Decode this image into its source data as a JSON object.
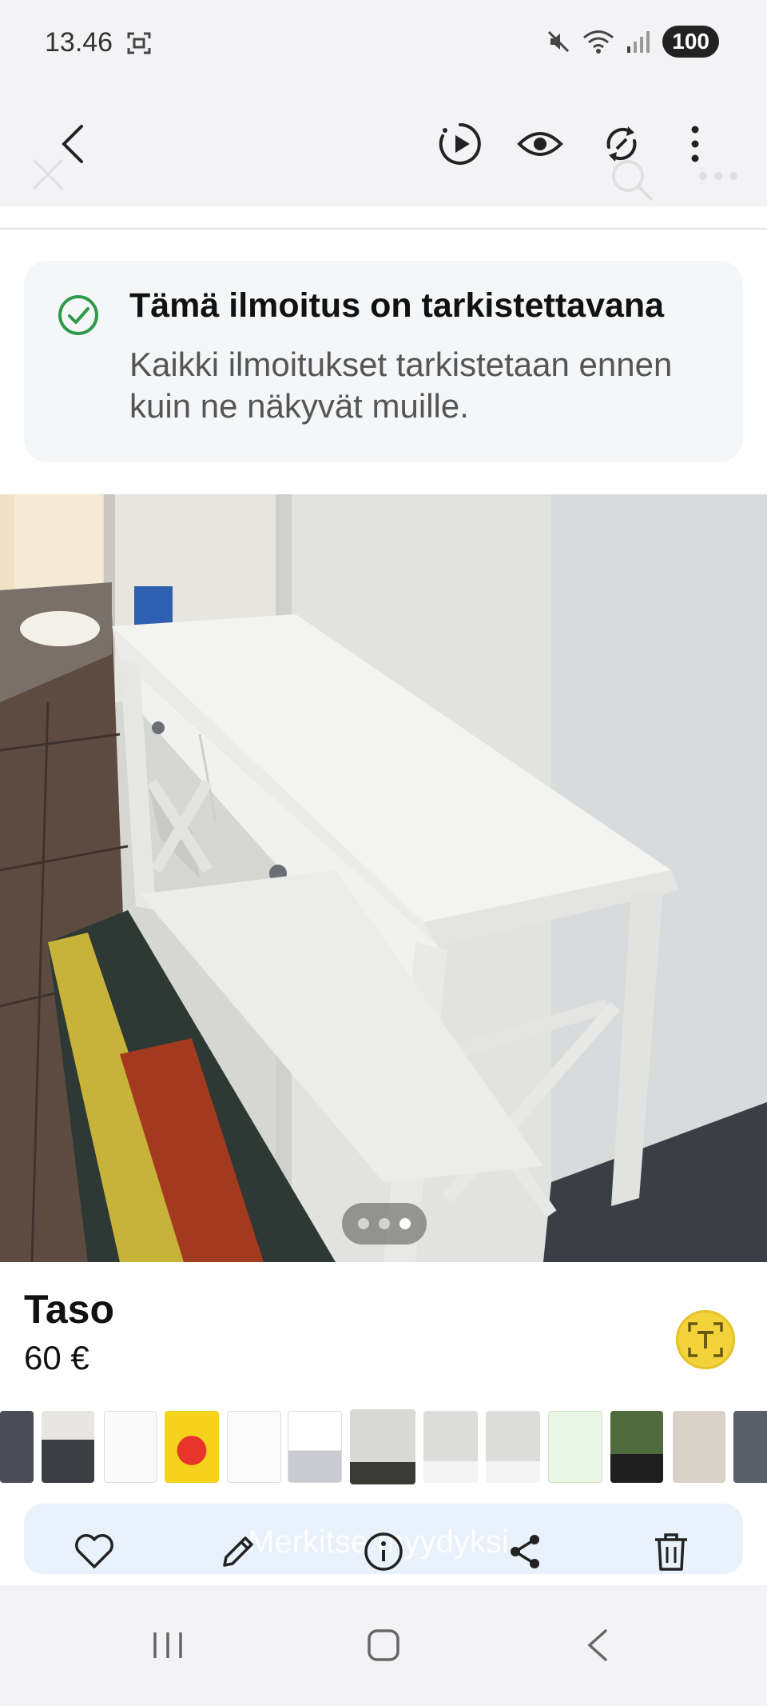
{
  "status_bar": {
    "time": "13.46",
    "battery": "100",
    "icons": [
      "screenshot-icon",
      "mute-icon",
      "wifi-icon",
      "signal-icon"
    ]
  },
  "toolbar": {
    "icons": [
      "back-icon",
      "play-motion-icon",
      "eye-icon",
      "rotate-icon",
      "more-icon"
    ]
  },
  "banner": {
    "title": "Tämä ilmoitus on tarkistettavana",
    "text": "Kaikki ilmoitukset tarkistetaan ennen kuin ne näkyvät muille.",
    "accent": "#2e9a4a"
  },
  "photo": {
    "pages": 3,
    "active_page": 3
  },
  "listing": {
    "title": "Taso",
    "price": "60 €"
  },
  "thumbnails": {
    "count": 13,
    "selected_index": 5
  },
  "actions": {
    "ghost_label": "Merkitse myydyksi",
    "icons": [
      "heart-icon",
      "edit-icon",
      "info-icon",
      "share-icon",
      "trash-icon"
    ]
  },
  "navbar": {
    "icons": [
      "recents-icon",
      "home-icon",
      "nav-back-icon"
    ]
  }
}
